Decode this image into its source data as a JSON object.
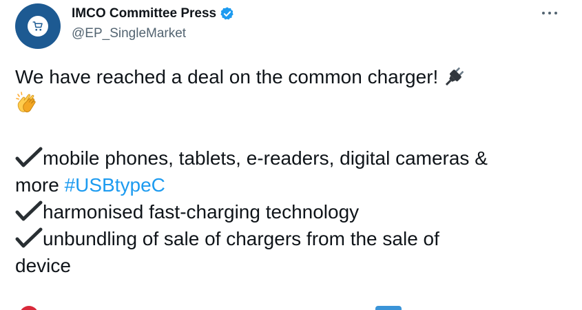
{
  "author": {
    "display_name": "IMCO Committee Press",
    "handle": "@EP_SingleMarket",
    "avatar_icon": "shopping-cart-icon",
    "avatar_color": "#1d5a92",
    "verified_color": "#1d9bf0"
  },
  "tweet": {
    "line1": "We have reached a deal on the common charger!",
    "list": [
      {
        "text": "mobile phones, tablets, e-readers, digital cameras &"
      },
      {
        "text_before_hashtag": "more ",
        "hashtag": "#USBtypeC"
      },
      {
        "text": "harmonised fast-charging technology"
      },
      {
        "text": "unbundling of sale of chargers from the sale of"
      },
      {
        "text": "device"
      }
    ],
    "hashtag_color": "#1d9bf0"
  }
}
